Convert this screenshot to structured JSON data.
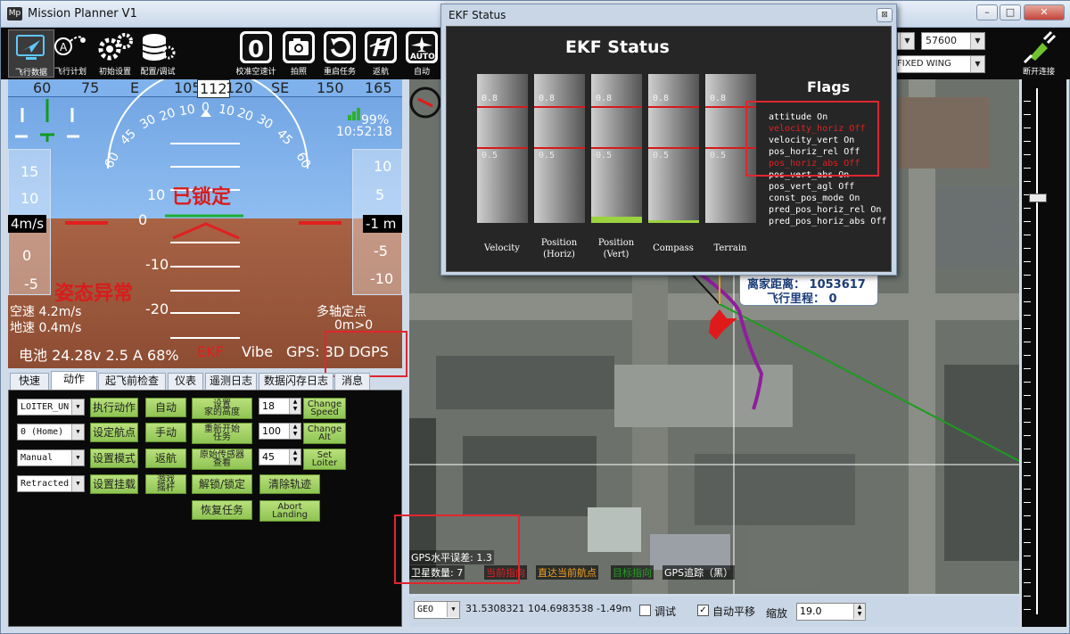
{
  "window": {
    "title": "Mission Planner V1",
    "icon": "Mp"
  },
  "toolbar": {
    "items": [
      {
        "label": "飞行数据",
        "icon": "flight-data-icon"
      },
      {
        "label": "飞行计划",
        "icon": "flight-plan-icon"
      },
      {
        "label": "初始设置",
        "icon": "gear-icon"
      },
      {
        "label": "配置/调试",
        "icon": "database-icon"
      }
    ],
    "actions": [
      {
        "label": "校准空速计",
        "glyph": "0"
      },
      {
        "label": "拍照",
        "glyph": "📷"
      },
      {
        "label": "重启任务",
        "glyph": "↻"
      },
      {
        "label": "返航",
        "glyph": "H"
      },
      {
        "label": "自动",
        "glyph": "AUTO"
      }
    ],
    "baud": "57600",
    "frame": "FIXED WING",
    "connect_label": "断开连接"
  },
  "hud": {
    "heading_ticks": [
      "60",
      "75",
      "E",
      "105",
      "112",
      "120",
      "SE",
      "150",
      "165"
    ],
    "roll_ticks": [
      "60",
      "45",
      "30",
      "20",
      "10",
      "0",
      "10",
      "20",
      "30",
      "45",
      "60"
    ],
    "pitch_ticks": [
      "10",
      "0",
      "-10",
      "-20"
    ],
    "speed_ticks": [
      "15",
      "10",
      "0",
      "-5"
    ],
    "speed_value": "4m/s",
    "alt_ticks": [
      "10",
      "5",
      "-5",
      "-10"
    ],
    "alt_value": "-1 m",
    "battery_pct": "99%",
    "time": "10:52:18",
    "armed_text": "已锁定",
    "attitude_warning": "姿态异常",
    "airspeed": "空速 4.2m/s",
    "groundspeed": "地速 0.4m/s",
    "mode": "多轴定点",
    "distance": "0m>0",
    "battery_line": "电池 24.28v 2.5 A 68%",
    "ekf_label": "EKF",
    "vibe_label": "Vibe",
    "gps_label": "GPS: 3D DGPS"
  },
  "tabs": [
    "快速",
    "动作",
    "起飞前检查",
    "仪表",
    "遥测日志",
    "数据闪存日志",
    "消息"
  ],
  "actions_panel": {
    "combos": [
      "LOITER_UN",
      "0 (Home)",
      "Manual",
      "Retracted"
    ],
    "buttons_col1": [
      "执行动作",
      "设定航点",
      "设置模式",
      "设置挂载"
    ],
    "buttons_col2": [
      "自动",
      "手动",
      "返航",
      "游戏\n摇杆"
    ],
    "buttons_col3": [
      "设置\n家的高度",
      "重新开始\n任务",
      "原始传感器\n查看",
      "解锁/锁定",
      "恢复任务"
    ],
    "spins": [
      "18",
      "100",
      "45"
    ],
    "buttons_col4": [
      "Change\nSpeed",
      "Change\nAlt",
      "Set\nLoiter",
      "清除轨迹",
      "Abort\nLanding"
    ]
  },
  "map": {
    "distance_label": "离家距离： 1053617",
    "mileage_label": "飞行里程： 0",
    "gps_hdop": "GPS水平误差: 1.3",
    "sat_count": "卫星数量: 7",
    "legend": [
      {
        "label": "当前指向",
        "color": "#e02222"
      },
      {
        "label": "直达当前航点",
        "color": "#f0a020"
      },
      {
        "label": "目标指向",
        "color": "#22a022"
      },
      {
        "label": "GPS追踪（黑）",
        "color": "#111111"
      }
    ]
  },
  "statusbar": {
    "coord_system": "GEO",
    "coords": "31.5308321 104.6983538",
    "alt": "-1.49m",
    "debug_label": "调试",
    "autopan_label": "自动平移",
    "zoom_label": "缩放",
    "zoom_value": "19.0"
  },
  "ekf": {
    "window_title": "EKF Status",
    "heading": "EKF Status",
    "flags_title": "Flags",
    "bars": [
      {
        "label": "Velocity",
        "fill": 0
      },
      {
        "label": "Position\n(Horiz)",
        "fill": 0
      },
      {
        "label": "Position\n(Vert)",
        "fill": 0.04
      },
      {
        "label": "Compass",
        "fill": 0.02
      },
      {
        "label": "Terrain",
        "fill": 0
      }
    ],
    "line_08": "0.8",
    "line_05": "0.5",
    "flags": [
      {
        "text": "attitude On",
        "color": "#ffffff"
      },
      {
        "text": "velocity_horiz Off",
        "color": "#e02222"
      },
      {
        "text": "velocity_vert On",
        "color": "#ffffff"
      },
      {
        "text": "pos_horiz_rel Off",
        "color": "#ffffff"
      },
      {
        "text": "pos_horiz_abs Off",
        "color": "#e02222"
      },
      {
        "text": "pos_vert_abs On",
        "color": "#ffffff"
      },
      {
        "text": "pos_vert_agl Off",
        "color": "#ffffff"
      },
      {
        "text": "const_pos_mode On",
        "color": "#ffffff"
      },
      {
        "text": "pred_pos_horiz_rel On",
        "color": "#ffffff"
      },
      {
        "text": "pred_pos_horiz_abs Off",
        "color": "#ffffff"
      }
    ]
  }
}
